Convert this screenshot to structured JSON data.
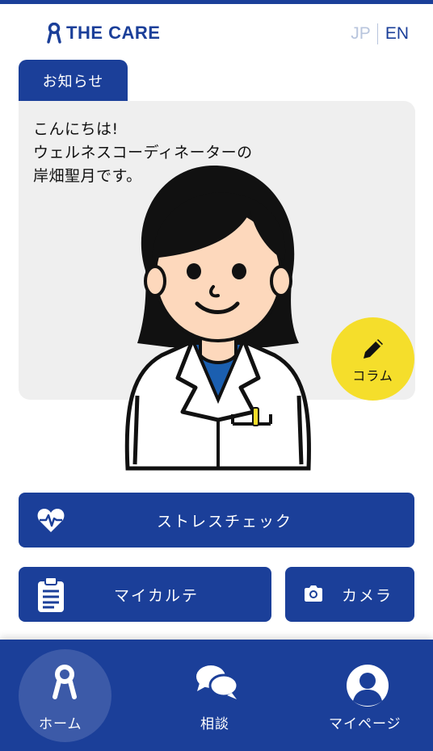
{
  "header": {
    "logo_text": "THE CARE",
    "lang_jp": "JP",
    "lang_en": "EN"
  },
  "notice": {
    "tab_label": "お知らせ",
    "greeting_lines": [
      "こんにちは!",
      "ウェルネスコーディネーターの",
      "岸畑聖月です。"
    ]
  },
  "column_button": {
    "label": "コラム",
    "icon": "pencil-icon"
  },
  "actions": {
    "stress_check": {
      "label": "ストレスチェック",
      "icon": "heartbeat-icon"
    },
    "my_karte": {
      "label": "マイカルテ",
      "icon": "clipboard-icon"
    },
    "camera": {
      "label": "カメラ",
      "icon": "camera-icon"
    }
  },
  "bottom_nav": {
    "items": [
      {
        "label": "ホーム",
        "icon": "home-logo-icon",
        "active": true
      },
      {
        "label": "相談",
        "icon": "chat-bubbles-icon",
        "active": false
      },
      {
        "label": "マイページ",
        "icon": "user-icon",
        "active": false
      }
    ]
  },
  "colors": {
    "brand_blue": "#1b3f99",
    "active_nav_bg": "#3c5aa8",
    "accent_yellow": "#f5de2b",
    "card_bg": "#efefef",
    "lang_inactive": "#b8c5dd"
  }
}
